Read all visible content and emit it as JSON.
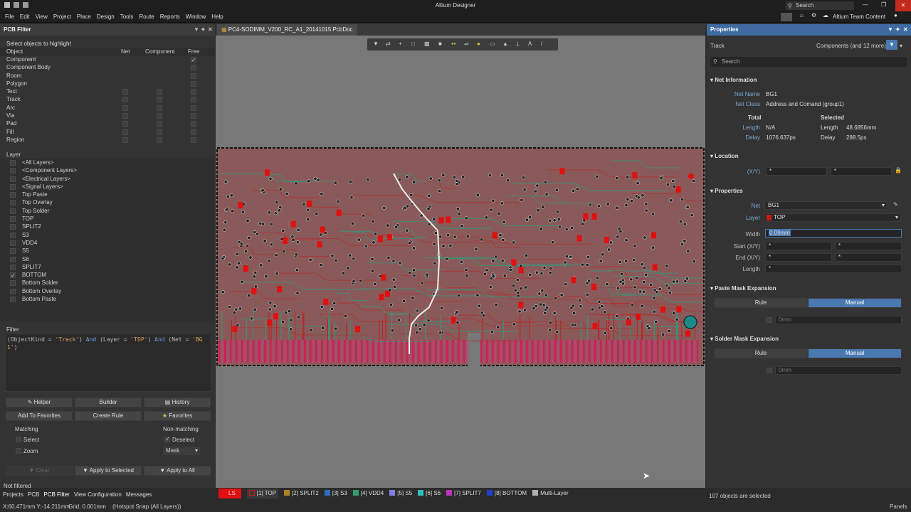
{
  "app": {
    "title": "Altium Designer",
    "search_placeholder": "Search",
    "team": "Altium Team Content"
  },
  "menu": [
    "File",
    "Edit",
    "View",
    "Project",
    "Place",
    "Design",
    "Tools",
    "Route",
    "Reports",
    "Window",
    "Help"
  ],
  "left": {
    "panel_title": "PCB Filter",
    "select_title": "Select objects to highlight",
    "columns": [
      "Object",
      "Net",
      "Component",
      "Free"
    ],
    "objects": [
      "Component",
      "Component Body",
      "Room",
      "Polygon",
      "Text",
      "Track",
      "Arc",
      "Via",
      "Pad",
      "Fill",
      "Region"
    ],
    "layer_title": "Layer",
    "layers": [
      "<All Layers>",
      "<Component Layers>",
      "<Electrical Layers>",
      "<Signal Layers>",
      "Top Paste",
      "Top Overlay",
      "Top Solder",
      "TOP",
      "SPLIT2",
      "S3",
      "VDD4",
      "S5",
      "S6",
      "SPLIT7",
      "BOTTOM",
      "Bottom Solder",
      "Bottom Overlay",
      "Bottom Paste"
    ],
    "filter_title": "Filter",
    "filter_parts": [
      "(ObjectKind = ",
      "'Track'",
      ") ",
      "And",
      " (Layer = ",
      "'TOP'",
      ") ",
      "And",
      " (Net =",
      "'BG1'",
      ")"
    ],
    "buttons": {
      "helper": "Helper",
      "builder": "Builder",
      "history": "History",
      "add_fav": "Add To Favorites",
      "create_rule": "Create Rule",
      "favorites": "Favorites",
      "clear": "Clear",
      "apply_sel": "Apply to Selected",
      "apply_all": "Apply to All"
    },
    "matching": "Matching",
    "non_matching": "Non-matching",
    "select": "Select",
    "zoom": "Zoom",
    "deselect": "Deselect",
    "mask": "Mask"
  },
  "doc": {
    "tab": "PC4-SODIMM_V200_RC_A1_20141015.PcbDoc"
  },
  "right": {
    "title": "Properties",
    "obj": "Track",
    "filter_summary": "Components (and 12 more)",
    "search": "Search",
    "net_info": "Net Information",
    "net_name_lbl": "Net Name",
    "net_name": "BG1",
    "net_class_lbl": "Net Class",
    "net_class": "Address and Comand (group1)",
    "total": "Total",
    "selected": "Selected",
    "length_lbl": "Length",
    "length_total": "N/A",
    "length_sel": "48.6856mm",
    "delay_lbl": "Delay",
    "delay_total": "1076.637ps",
    "delay_sel": "288.5ps",
    "location": "Location",
    "xy": "(X/Y)",
    "properties": "Properties",
    "net_lbl": "Net",
    "net_val": "BG1",
    "layer_lbl": "Layer",
    "layer_val": "TOP",
    "width_lbl": "Width",
    "width_val": "0.09mm",
    "start_lbl": "Start (X/Y)",
    "end_lbl": "End (X/Y)",
    "length2_lbl": "Length",
    "star": "*",
    "paste_mask": "Paste Mask Expansion",
    "solder_mask": "Solder Mask Expansion",
    "rule": "Rule",
    "manual": "Manual",
    "zero": "0mm"
  },
  "bottom": {
    "not_filtered": "Not filtered",
    "tabs": [
      "Projects",
      "PCB",
      "PCB Filter",
      "View Configuration",
      "Messages"
    ],
    "coords": "X:60.471mm Y:-14.211mm",
    "grid": "Grid: 0.001mm",
    "snap": "(Hotspot Snap (All Layers))",
    "layers": [
      {
        "label": "LS",
        "color": "#e01010"
      },
      {
        "label": "[1] TOP",
        "color": "#e01010"
      },
      {
        "label": "[2] SPLIT2",
        "color": "#b08020"
      },
      {
        "label": "[3] S3",
        "color": "#3070c0"
      },
      {
        "label": "[4] VDD4",
        "color": "#30a070"
      },
      {
        "label": "[5] S5",
        "color": "#8080e0"
      },
      {
        "label": "[6] S6",
        "color": "#30c0c0"
      },
      {
        "label": "[7] SPLIT7",
        "color": "#c030c0"
      },
      {
        "label": "[8] BOTTOM",
        "color": "#2040d0"
      },
      {
        "label": "Multi-Layer",
        "color": "#b0b0b0"
      }
    ],
    "selected_count": "107 objects are selected",
    "panels": "Panels"
  },
  "colors": {
    "accent": "#4a78b0",
    "track_red": "#d01818",
    "board": "#8a5a5a"
  }
}
